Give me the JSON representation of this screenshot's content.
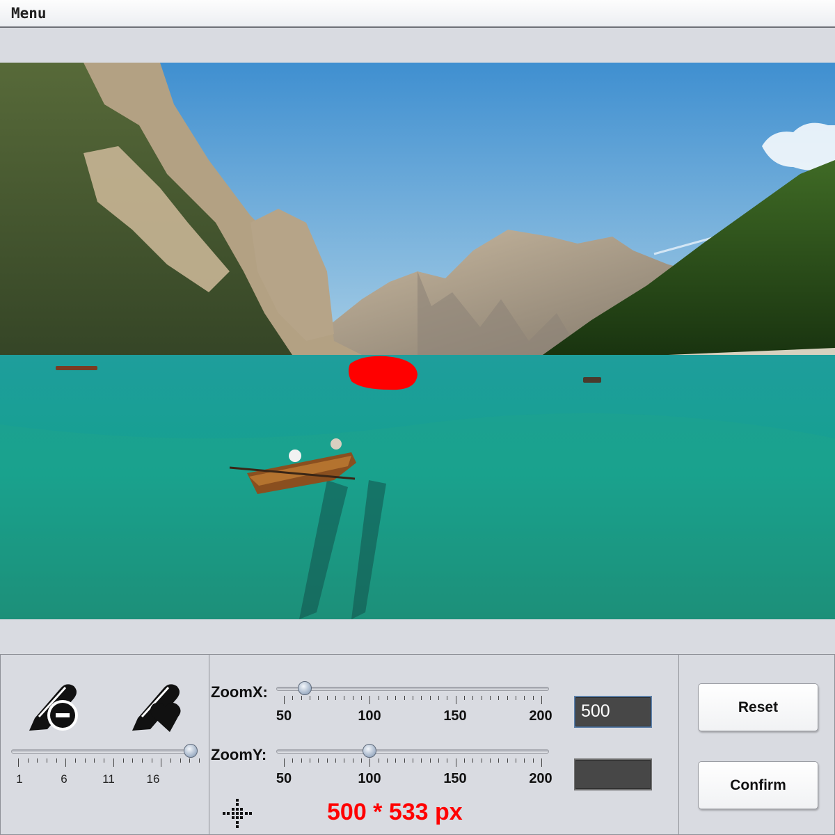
{
  "menu": {
    "label": "Menu"
  },
  "brush": {
    "size_ticks": [
      "1",
      "6",
      "11",
      "16"
    ],
    "size_value": 20,
    "size_min": 1,
    "size_max": 20
  },
  "zoom": {
    "x_label": "ZoomX:",
    "y_label": "ZoomY:",
    "tick_labels": [
      "50",
      "100",
      "150",
      "200"
    ],
    "x_value": 62,
    "y_value": 100,
    "min": 50,
    "max": 200,
    "x_field": "500",
    "y_field": ""
  },
  "readout": {
    "size_text": "500 * 533 px",
    "color": "#ff0000"
  },
  "buttons": {
    "reset": "Reset",
    "confirm": "Confirm"
  },
  "icons": {
    "eraser_tool": "pen-minus-icon",
    "heart_pen_tool": "pen-heart-icon",
    "move": "move-crosshair-icon"
  }
}
